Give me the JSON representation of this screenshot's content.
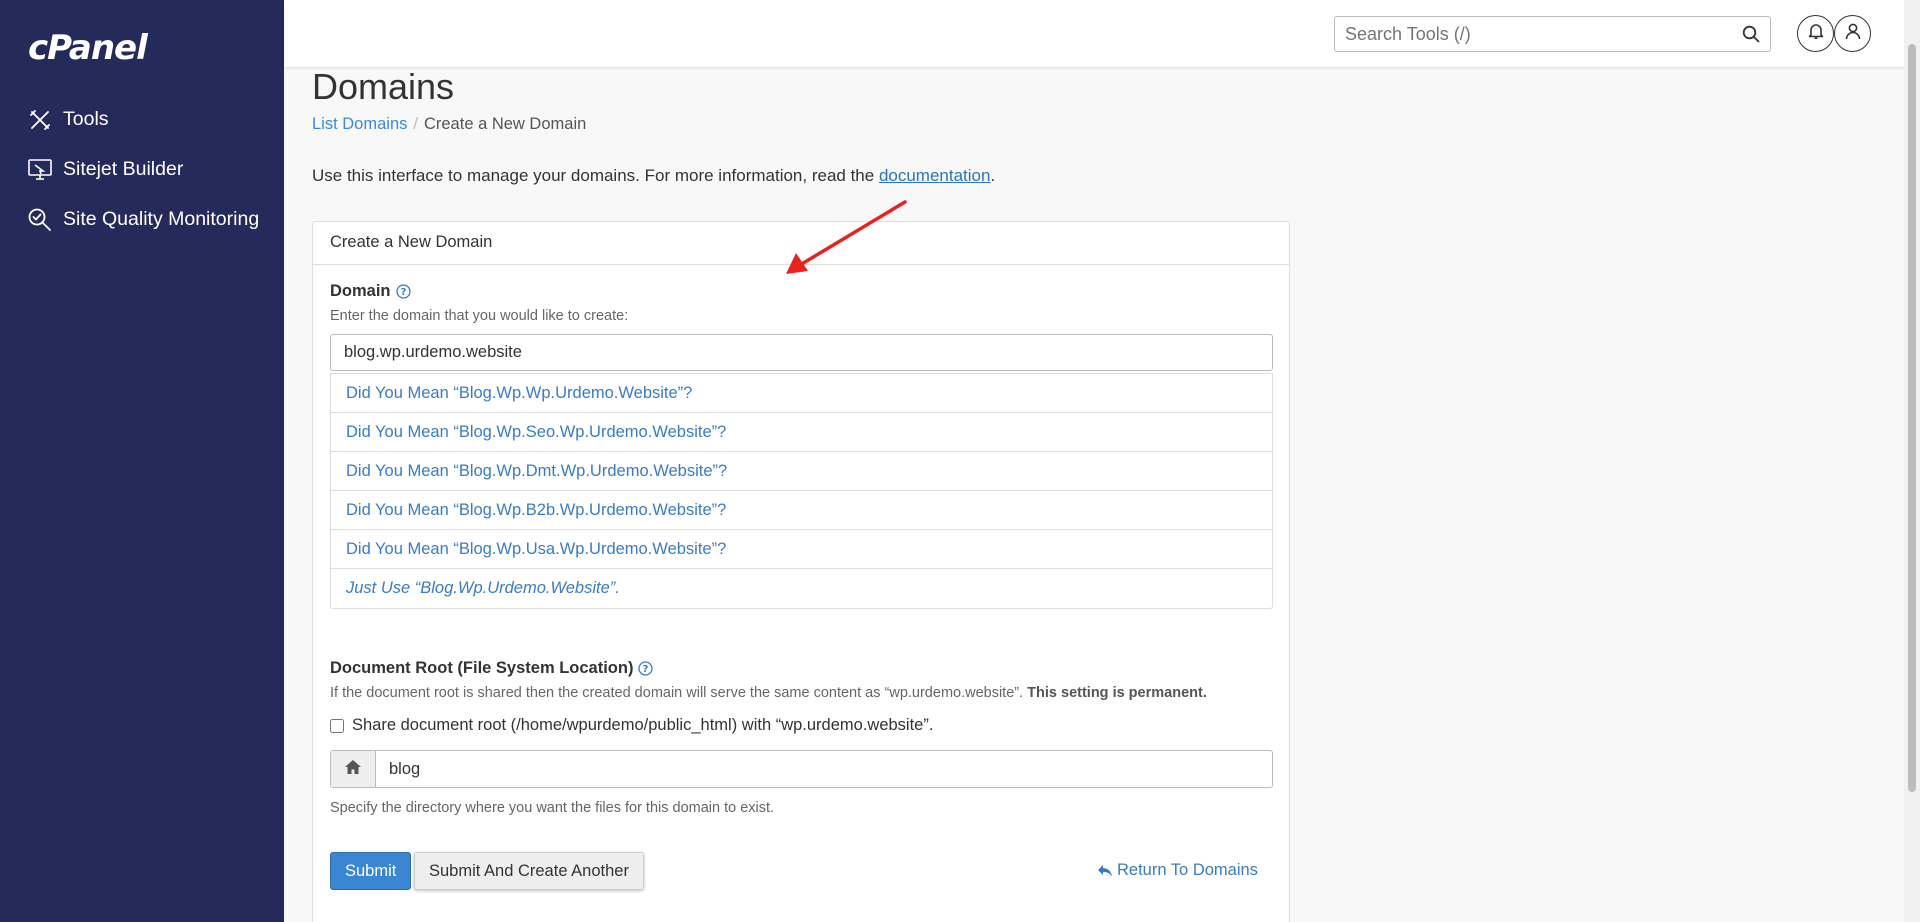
{
  "sidebar": {
    "logo": "cPanel",
    "items": [
      {
        "label": "Tools",
        "icon": "tools-icon"
      },
      {
        "label": "Sitejet Builder",
        "icon": "sitejet-icon"
      },
      {
        "label": "Site Quality Monitoring",
        "icon": "site-quality-icon"
      }
    ]
  },
  "header": {
    "search_placeholder": "Search Tools (/)"
  },
  "page": {
    "title": "Domains",
    "breadcrumb": {
      "link": "List Domains",
      "separator": "/",
      "current": "Create a New Domain"
    },
    "intro_prefix": "Use this interface to manage your domains. For more information, read the ",
    "intro_link": "documentation",
    "intro_suffix": "."
  },
  "form": {
    "panel_title": "Create a New Domain",
    "domain_label": "Domain",
    "domain_hint": "Enter the domain that you would like to create:",
    "domain_value": "blog.wp.urdemo.website",
    "suggestions": [
      "Did You Mean “Blog.Wp.Wp.Urdemo.Website”?",
      "Did You Mean “Blog.Wp.Seo.Wp.Urdemo.Website”?",
      "Did You Mean “Blog.Wp.Dmt.Wp.Urdemo.Website”?",
      "Did You Mean “Blog.Wp.B2b.Wp.Urdemo.Website”?",
      "Did You Mean “Blog.Wp.Usa.Wp.Urdemo.Website”?",
      "Just Use “Blog.Wp.Urdemo.Website”."
    ],
    "docroot_label": "Document Root (File System Location)",
    "docroot_hint_prefix": "If the document root is shared then the created domain will serve the same content as “wp.urdemo.website”. ",
    "docroot_hint_bold": "This setting is permanent.",
    "share_label": "Share document root (/home/wpurdemo/public_html) with “wp.urdemo.website”.",
    "share_checked": false,
    "docroot_value": "blog",
    "docroot_help": "Specify the directory where you want the files for this domain to exist.",
    "submit_label": "Submit",
    "submit_another_label": "Submit And Create Another",
    "return_label": "Return To Domains"
  },
  "colors": {
    "sidebar_bg": "#242a59",
    "link": "#3a7cc4",
    "primary_button": "#3a86d2",
    "annotation_arrow": "#e8231f"
  }
}
